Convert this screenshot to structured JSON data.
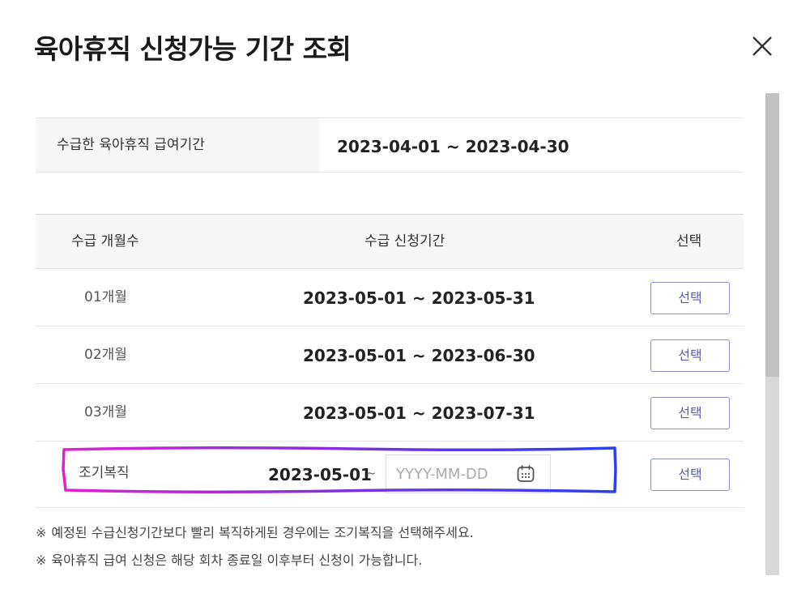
{
  "dialog": {
    "title": "육아휴직 신청가능 기간 조회"
  },
  "summary": {
    "label": "수급한 육아휴직 급여기간",
    "value": "2023-04-01 ~ 2023-04-30"
  },
  "table": {
    "headers": {
      "months": "수급 개월수",
      "period": "수급 신청기간",
      "select": "선택"
    },
    "rows": [
      {
        "months": "01개월",
        "period": "2023-05-01 ~ 2023-05-31",
        "button": "선택"
      },
      {
        "months": "02개월",
        "period": "2023-05-01 ~ 2023-06-30",
        "button": "선택"
      },
      {
        "months": "03개월",
        "period": "2023-05-01 ~ 2023-07-31",
        "button": "선택"
      }
    ],
    "early_return": {
      "label": "조기복직",
      "start": "2023-05-01",
      "tilde": "~",
      "end_placeholder": "YYYY-MM-DD",
      "button": "선택"
    }
  },
  "notes": [
    {
      "mark": "※",
      "text": "예정된 수급신청기간보다 빨리 복직하게된 경우에는 조기복직을 선택해주세요."
    },
    {
      "mark": "※",
      "text": "육아휴직 급여 신청은 해당 회차 종료일 이후부터 신청이 가능합니다."
    }
  ],
  "colors": {
    "button_border": "#8a8fc9",
    "button_text": "#5a5fb0",
    "highlight_start": "#e020d0",
    "highlight_end": "#2a40f0"
  },
  "icons": {
    "close": "close-icon",
    "calendar": "calendar-icon"
  }
}
